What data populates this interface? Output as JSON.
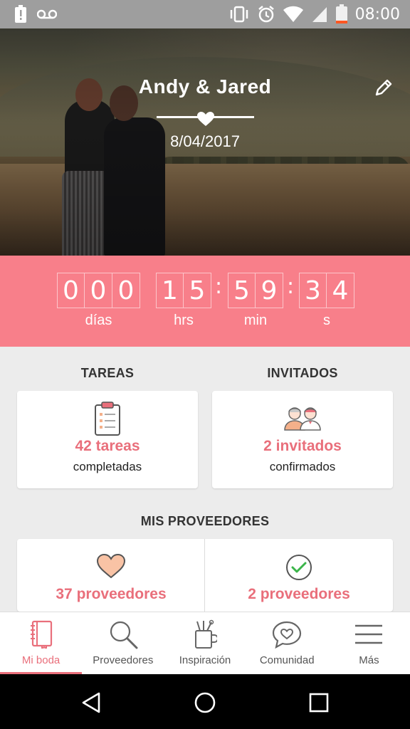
{
  "status_bar": {
    "time": "08:00",
    "icons": [
      "alert-icon",
      "voicemail-icon",
      "vibrate-icon",
      "alarm-icon",
      "wifi-icon",
      "signal-icon",
      "battery-icon"
    ]
  },
  "hero": {
    "title": "Andy & Jared",
    "date": "8/04/2017",
    "edit_icon": "pencil-icon"
  },
  "countdown": {
    "days_digits": [
      "0",
      "0",
      "0"
    ],
    "hours_digits": [
      "1",
      "5"
    ],
    "minutes_digits": [
      "5",
      "9"
    ],
    "seconds_digits": [
      "3",
      "4"
    ],
    "separator": ":",
    "labels": {
      "days": "días",
      "hours": "hrs",
      "minutes": "min",
      "seconds": "s"
    }
  },
  "summary": {
    "tasks_heading": "TAREAS",
    "guests_heading": "INVITADOS",
    "tasks_card": {
      "count": "42 tareas",
      "caption": "completadas",
      "icon": "clipboard-checklist-icon"
    },
    "guests_card": {
      "count": "2 invitados",
      "caption": "confirmados",
      "icon": "guests-couple-icon"
    }
  },
  "providers": {
    "heading": "MIS PROVEEDORES",
    "items": [
      {
        "count": "37 proveedores",
        "icon": "heart-icon"
      },
      {
        "count": "2 proveedores",
        "icon": "check-circle-icon"
      }
    ]
  },
  "bottom_nav": {
    "items": [
      {
        "label": "Mi boda",
        "icon": "notebook-icon",
        "active": true
      },
      {
        "label": "Proveedores",
        "icon": "search-icon",
        "active": false
      },
      {
        "label": "Inspiración",
        "icon": "pencil-cup-icon",
        "active": false
      },
      {
        "label": "Comunidad",
        "icon": "chat-heart-icon",
        "active": false
      },
      {
        "label": "Más",
        "icon": "hamburger-menu-icon",
        "active": false
      }
    ]
  },
  "colors": {
    "accent": "#e96f7b",
    "countdown_bg": "#f87f8a",
    "background": "#ececec"
  }
}
